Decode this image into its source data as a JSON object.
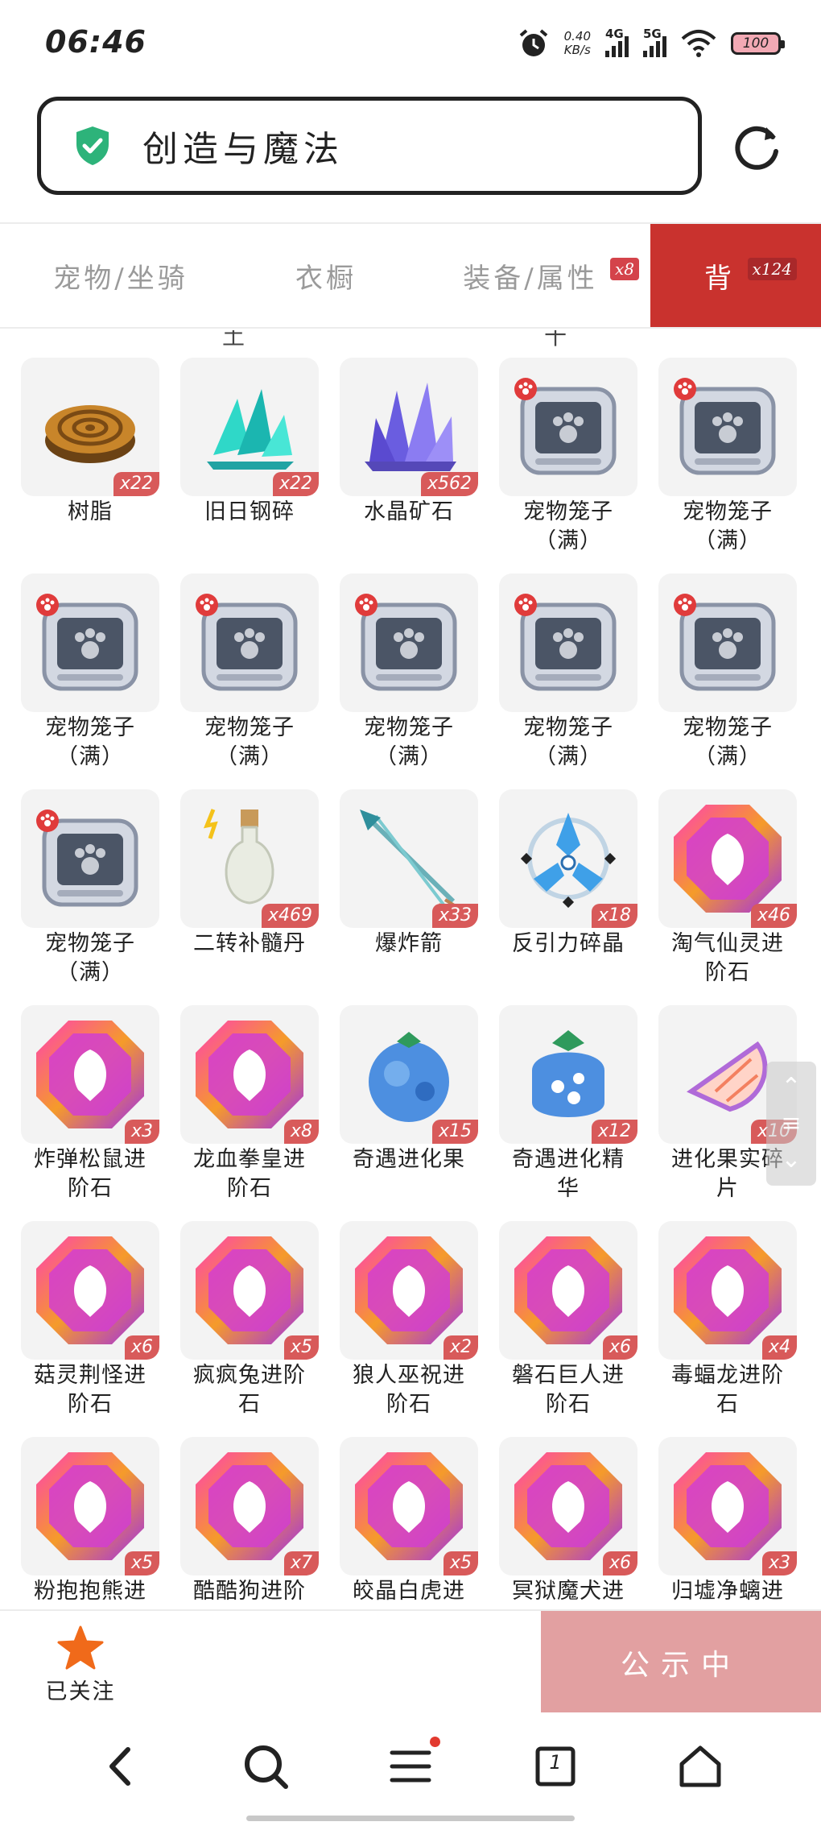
{
  "status_bar": {
    "time": "06:46",
    "net_speed_value": "0.40",
    "net_speed_unit": "KB/s",
    "signal_1": "4G",
    "signal_2": "5G",
    "battery": "100"
  },
  "address_bar": {
    "title": "创造与魔法"
  },
  "tabs": [
    {
      "label": "宠物/坐骑",
      "badge": ""
    },
    {
      "label": "衣橱",
      "badge": ""
    },
    {
      "label": "装备/属性",
      "badge": "x8"
    },
    {
      "label": "背",
      "badge": "x124",
      "active": true
    }
  ],
  "peek_labels": [
    "土",
    "十"
  ],
  "items": [
    {
      "name": "树脂",
      "qty": "x22",
      "icon": "resin-icon"
    },
    {
      "name": "旧日钢碎",
      "qty": "x22",
      "icon": "steel-shard-icon"
    },
    {
      "name": "水晶矿石",
      "qty": "x562",
      "icon": "crystal-ore-icon"
    },
    {
      "name": "宠物笼子\n（满）",
      "qty": "",
      "icon": "pet-cage-icon"
    },
    {
      "name": "宠物笼子\n（满）",
      "qty": "",
      "icon": "pet-cage-icon"
    },
    {
      "name": "宠物笼子\n（满）",
      "qty": "",
      "icon": "pet-cage-icon"
    },
    {
      "name": "宠物笼子\n（满）",
      "qty": "",
      "icon": "pet-cage-icon"
    },
    {
      "name": "宠物笼子\n（满）",
      "qty": "",
      "icon": "pet-cage-icon"
    },
    {
      "name": "宠物笼子\n（满）",
      "qty": "",
      "icon": "pet-cage-icon"
    },
    {
      "name": "宠物笼子\n（满）",
      "qty": "",
      "icon": "pet-cage-icon"
    },
    {
      "name": "宠物笼子\n（满）",
      "qty": "",
      "icon": "pet-cage-icon"
    },
    {
      "name": "二转补髓丹",
      "qty": "x469",
      "icon": "potion-bottle-icon"
    },
    {
      "name": "爆炸箭",
      "qty": "x33",
      "icon": "arrow-icon"
    },
    {
      "name": "反引力碎晶",
      "qty": "x18",
      "icon": "antigravity-crystal-icon"
    },
    {
      "name": "淘气仙灵进\n阶石",
      "qty": "x46",
      "icon": "evolution-stone-icon"
    },
    {
      "name": "炸弹松鼠进\n阶石",
      "qty": "x3",
      "icon": "evolution-stone-icon"
    },
    {
      "name": "龙血拳皇进\n阶石",
      "qty": "x8",
      "icon": "evolution-stone-icon"
    },
    {
      "name": "奇遇进化果",
      "qty": "x15",
      "icon": "evolution-fruit-icon"
    },
    {
      "name": "奇遇进化精\n华",
      "qty": "x12",
      "icon": "evolution-essence-icon"
    },
    {
      "name": "进化果实碎\n片",
      "qty": "x10",
      "icon": "fruit-fragment-icon"
    },
    {
      "name": "菇灵荆怪进\n阶石",
      "qty": "x6",
      "icon": "evolution-stone-icon"
    },
    {
      "name": "疯疯兔进阶\n石",
      "qty": "x5",
      "icon": "evolution-stone-icon"
    },
    {
      "name": "狼人巫祝进\n阶石",
      "qty": "x2",
      "icon": "evolution-stone-icon"
    },
    {
      "name": "磐石巨人进\n阶石",
      "qty": "x6",
      "icon": "evolution-stone-icon"
    },
    {
      "name": "毒蝠龙进阶\n石",
      "qty": "x4",
      "icon": "evolution-stone-icon"
    },
    {
      "name": "粉抱抱熊进",
      "qty": "x5",
      "icon": "evolution-stone-icon"
    },
    {
      "name": "酷酷狗进阶",
      "qty": "x7",
      "icon": "evolution-stone-icon"
    },
    {
      "name": "皎晶白虎进",
      "qty": "x5",
      "icon": "evolution-stone-icon"
    },
    {
      "name": "冥狱魔犬进",
      "qty": "x6",
      "icon": "evolution-stone-icon"
    },
    {
      "name": "归墟净螭进",
      "qty": "x3",
      "icon": "evolution-stone-icon"
    }
  ],
  "action_bar": {
    "follow_label": "已关注",
    "status_label": "公示中"
  },
  "nav_bar": [
    "back-icon",
    "search-icon",
    "menu-icon",
    "tabs-icon",
    "home-icon"
  ],
  "tab_count": "1",
  "colors": {
    "accent": "#c9322e",
    "badge": "#d85a5a",
    "status_button": "#e2a0a1",
    "shield": "#2db37a",
    "star": "#f06a1a"
  }
}
